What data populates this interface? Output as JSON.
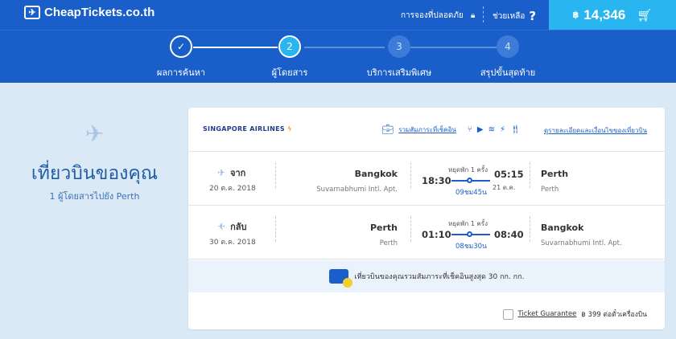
{
  "header": {
    "logo_text": "CheapTickets.co.th",
    "safe_booking": "การจองที่ปลอดภัย",
    "help": "ช่วยเหลือ",
    "price_currency": "฿",
    "price": "14,346"
  },
  "steps": [
    {
      "number": "✓",
      "label": "ผลการค้นหา",
      "state": "done"
    },
    {
      "number": "2",
      "label": "ผู้โดยสาร",
      "state": "active"
    },
    {
      "number": "3",
      "label": "บริการเสริมพิเศษ",
      "state": "todo"
    },
    {
      "number": "4",
      "label": "สรุปขั้นสุดท้าย",
      "state": "todo"
    }
  ],
  "summary": {
    "title": "เที่ยวบินของคุณ",
    "subtitle": "1 ผู้โดยสารไปยัง Perth"
  },
  "card": {
    "airline": "SINGAPORE AIRLINES",
    "baggage_included": "รวมสัมภาระที่เช็คอิน",
    "details_link": "ดูรายละเอียดและเงื่อนไขของเที่ยวบิน",
    "legs": [
      {
        "direction": "จาก",
        "date": "20 ต.ค. 2018",
        "from_city": "Bangkok",
        "from_airport": "Suvarnabhumi Intl. Apt.",
        "depart": "18:30",
        "stops": "หยุดพัก 1 ครั้ง",
        "duration": "09ชม45น",
        "arrive": "05:15",
        "next_day": "21 ต.ค.",
        "to_city": "Perth",
        "to_airport": "Perth"
      },
      {
        "direction": "กลับ",
        "date": "30 ต.ค. 2018",
        "from_city": "Perth",
        "from_airport": "Perth",
        "depart": "01:10",
        "stops": "หยุดพัก 1 ครั้ง",
        "duration": "08ชม30น",
        "arrive": "08:40",
        "next_day": "",
        "to_city": "Bangkok",
        "to_airport": "Suvarnabhumi Intl. Apt."
      }
    ],
    "baggage_note": "เที่ยวบินของคุณรวมสัมภาระที่เช็คอินสูงสุด 30 กก. กก.",
    "guarantee_label": "Ticket Guarantee",
    "guarantee_price": "฿ 399 ต่อตั๋วเครื่องบิน"
  },
  "colors": {
    "header_blue": "#1a5ec9",
    "accent_cyan": "#29b5f0",
    "page_bg": "#dbe9f7"
  }
}
